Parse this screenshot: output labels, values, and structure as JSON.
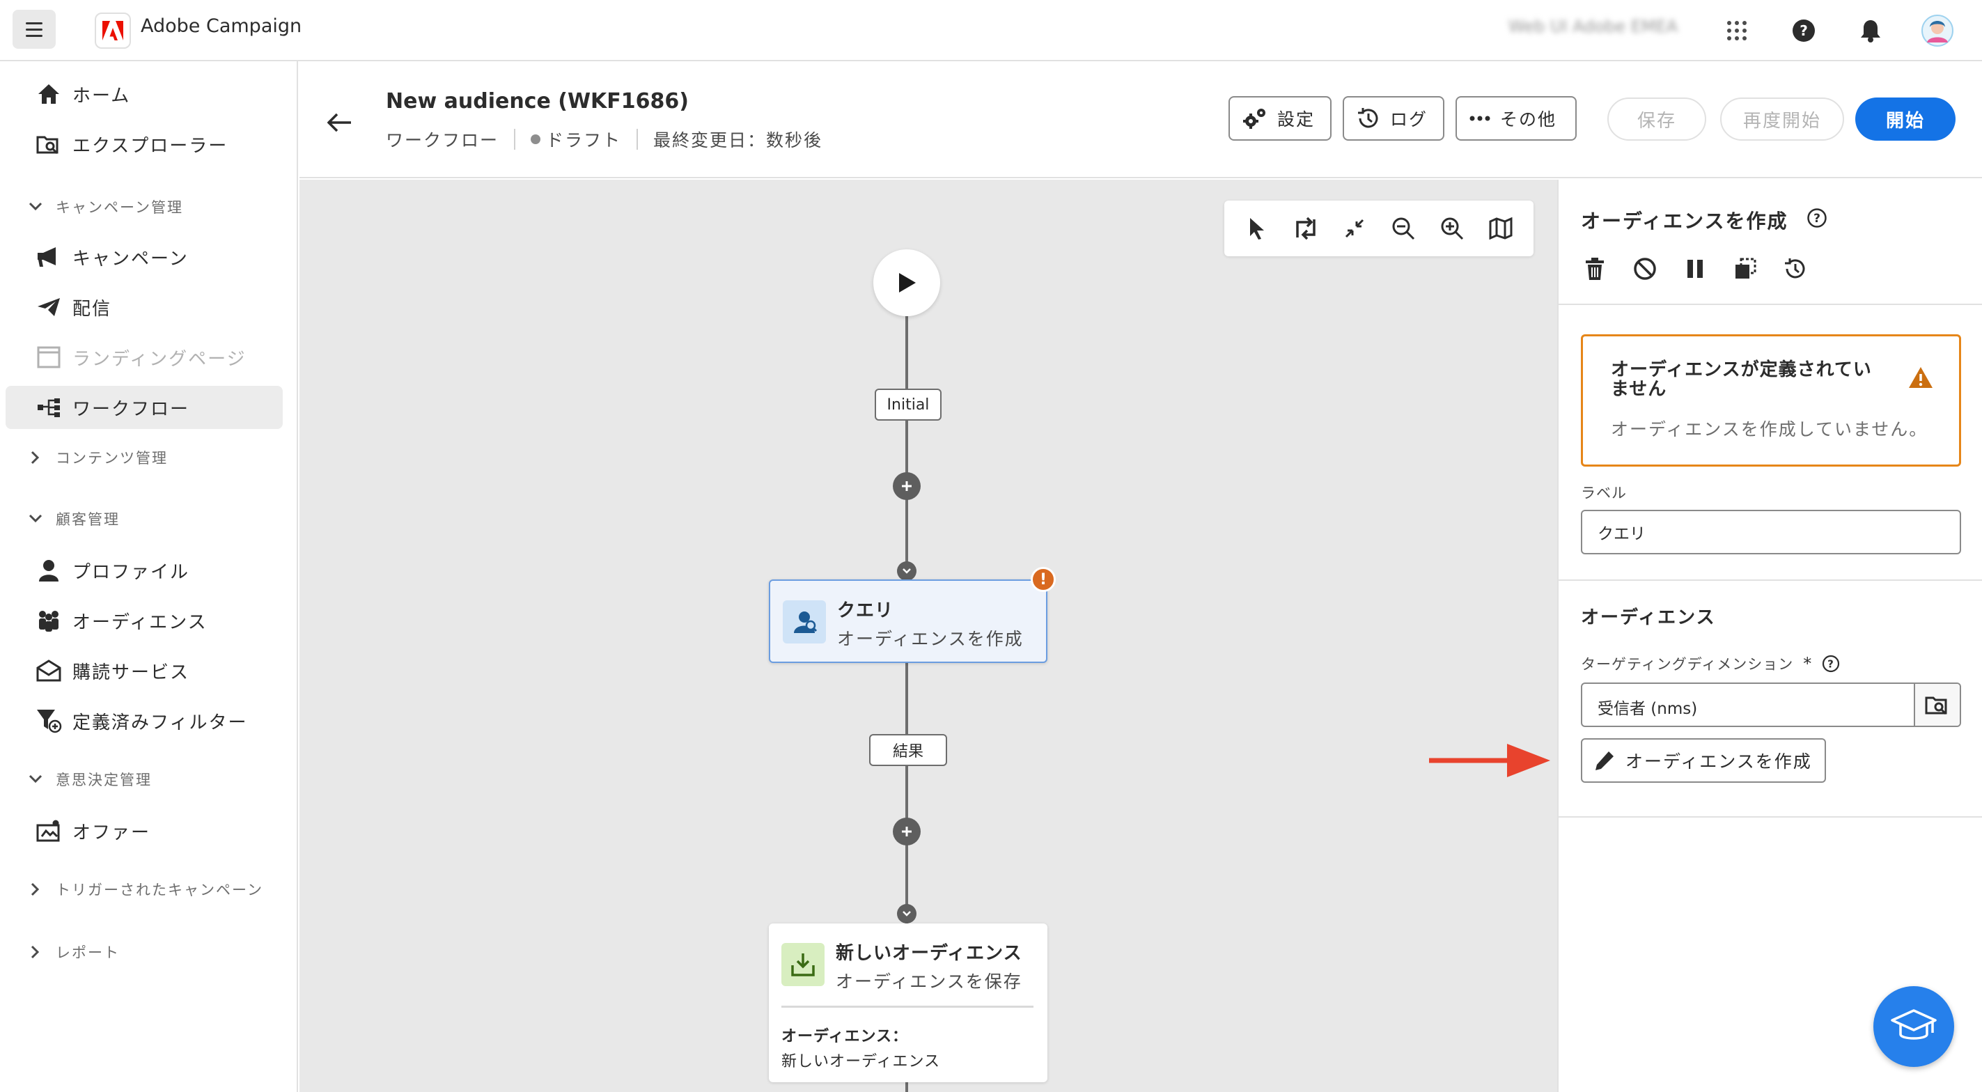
{
  "app": {
    "title": "Adobe Campaign",
    "org_name": "Web UI Adobe EMEA"
  },
  "sidebar": {
    "items": [
      {
        "label": "ホーム",
        "icon": "home-icon"
      },
      {
        "label": "エクスプローラー",
        "icon": "explorer-icon"
      },
      {
        "label": "キャンペーン",
        "icon": "megaphone-icon"
      },
      {
        "label": "配信",
        "icon": "send-icon"
      },
      {
        "label": "ランディングページ",
        "icon": "landing-page-icon",
        "disabled": true
      },
      {
        "label": "ワークフロー",
        "icon": "workflow-icon",
        "active": true
      },
      {
        "label": "プロファイル",
        "icon": "user-icon"
      },
      {
        "label": "オーディエンス",
        "icon": "audience-icon"
      },
      {
        "label": "購読サービス",
        "icon": "subscription-icon"
      },
      {
        "label": "定義済みフィルター",
        "icon": "filter-icon"
      },
      {
        "label": "オファー",
        "icon": "offer-icon"
      }
    ],
    "sections": [
      {
        "label": "キャンペーン管理",
        "expanded": true
      },
      {
        "label": "コンテンツ管理",
        "expanded": false
      },
      {
        "label": "顧客管理",
        "expanded": true
      },
      {
        "label": "意思決定管理",
        "expanded": true
      },
      {
        "label": "トリガーされたキャンペーン",
        "expanded": false
      },
      {
        "label": "レポート",
        "expanded": false
      }
    ]
  },
  "header": {
    "title": "New audience (WKF1686)",
    "type": "ワークフロー",
    "status": "ドラフト",
    "modified": "最終変更日：数秒後",
    "buttons": {
      "settings": "設定",
      "logs": "ログ",
      "more": "その他",
      "save": "保存",
      "restart": "再度開始",
      "start": "開始"
    }
  },
  "canvas": {
    "transition_initial": "Initial",
    "transition_result": "結果",
    "query_node": {
      "name": "クエリ",
      "subtitle": "オーディエンスを作成",
      "warning": "!"
    },
    "save_node": {
      "name": "新しいオーディエンス",
      "subtitle": "オーディエンスを保存",
      "audience_label": "オーディエンス：",
      "audience_value": "新しいオーディエンス"
    }
  },
  "panel": {
    "title": "オーディエンスを作成",
    "alert": {
      "title": "オーディエンスが定義されていません",
      "text": "オーディエンスを作成していません。"
    },
    "label_field": {
      "label": "ラベル",
      "value": "クエリ"
    },
    "audience_section": "オーディエンス",
    "targeting": {
      "label": "ターゲティングディメンション",
      "required": "*",
      "value": "受信者 (nms)"
    },
    "build_button": "オーディエンスを作成"
  },
  "colors": {
    "accent": "#1473e6",
    "warning": "#e68619",
    "annotation_arrow": "#e8432d"
  }
}
